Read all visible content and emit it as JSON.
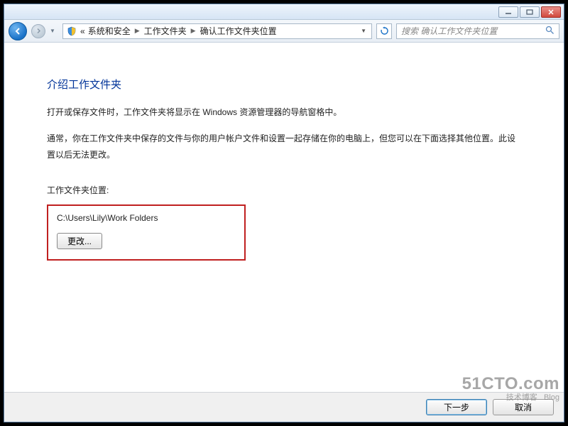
{
  "window": {
    "controls": {
      "min": "minimize",
      "max": "maximize",
      "close": "close"
    }
  },
  "nav": {
    "crumb_prefix": "«",
    "crumbs": [
      "系统和安全",
      "工作文件夹",
      "确认工作文件夹位置"
    ]
  },
  "search": {
    "placeholder": "搜索 确认工作文件夹位置"
  },
  "page": {
    "title": "介绍工作文件夹",
    "para1": "打开或保存文件时，工作文件夹将显示在 Windows 资源管理器的导航窗格中。",
    "para2": "通常，你在工作文件夹中保存的文件与你的用户帐户文件和设置一起存储在你的电脑上，但您可以在下面选择其他位置。此设置以后无法更改。",
    "location_label": "工作文件夹位置:",
    "path": "C:\\Users\\Lily\\Work Folders",
    "change_btn": "更改..."
  },
  "footer": {
    "next": "下一步",
    "cancel": "取消"
  },
  "watermark": {
    "line1": "51CTO.com",
    "line2": "技术博客",
    "line3": "Blog"
  }
}
